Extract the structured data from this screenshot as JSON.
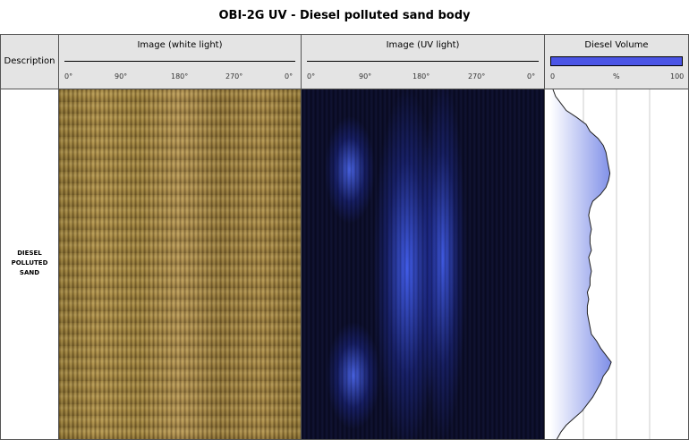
{
  "title": "OBI-2G UV - Diesel polluted sand body",
  "columns": {
    "description": {
      "header": "Description",
      "text_lines": [
        "DIESEL",
        "POLLUTED",
        "SAND"
      ]
    },
    "white_light": {
      "header": "Image (white light)",
      "ticks": [
        "0°",
        "90°",
        "180°",
        "270°",
        "0°"
      ]
    },
    "uv_light": {
      "header": "Image (UV light)",
      "ticks": [
        "0°",
        "90°",
        "180°",
        "270°",
        "0°"
      ]
    },
    "diesel_volume": {
      "header": "Diesel Volume",
      "scale_min": "0",
      "scale_unit": "%",
      "scale_max": "100",
      "legend_color": "#4b55e6"
    }
  },
  "chart_data": {
    "type": "area",
    "title": "Diesel Volume",
    "xlabel": "%",
    "xlim": [
      0,
      100
    ],
    "y_direction": "depth-down",
    "series": [
      {
        "depth_fraction": [
          0.0,
          0.02,
          0.04,
          0.06,
          0.08,
          0.1,
          0.12,
          0.14,
          0.16,
          0.18,
          0.2,
          0.22,
          0.24,
          0.26,
          0.28,
          0.3,
          0.32,
          0.34,
          0.36,
          0.38,
          0.4,
          0.42,
          0.44,
          0.46,
          0.48,
          0.5,
          0.52,
          0.54,
          0.56,
          0.58,
          0.6,
          0.62,
          0.64,
          0.66,
          0.68,
          0.7,
          0.72,
          0.74,
          0.76,
          0.78,
          0.8,
          0.82,
          0.84,
          0.86,
          0.88,
          0.9,
          0.92,
          0.94,
          0.96,
          0.98,
          1.0
        ],
        "values": [
          2,
          4,
          8,
          12,
          20,
          27,
          30,
          36,
          40,
          42,
          43,
          44,
          45,
          44,
          42,
          38,
          32,
          30,
          29,
          30,
          31,
          30,
          30,
          31,
          29,
          30,
          31,
          30,
          30,
          28,
          29,
          28,
          28,
          29,
          30,
          31,
          35,
          38,
          42,
          46,
          44,
          40,
          38,
          35,
          32,
          28,
          24,
          18,
          12,
          8,
          5
        ]
      }
    ]
  }
}
